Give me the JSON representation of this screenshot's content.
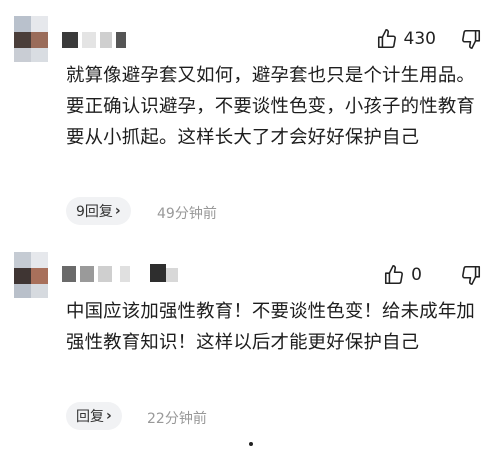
{
  "comments": [
    {
      "likes": "430",
      "text": "就算像避孕套又如何，避孕套也只是个计生用品。要正确认识避孕，不要谈性色变，小孩子的性教育要从小抓起。这样长大了才会好好保护自己",
      "reply_label": "9回复",
      "time": "49分钟前"
    },
    {
      "likes": "0",
      "text": "中国应该加强性教育！不要谈性色变！给未成年加强性教育知识！这样以后才能更好保护自己",
      "reply_label": "回复",
      "time": "22分钟前"
    }
  ],
  "icons": {
    "like": "thumbs-up-icon",
    "dislike": "thumbs-down-icon",
    "reply_chevron": "chevron-right-icon"
  },
  "colors": {
    "reply_bg": "#f1f2f4",
    "time_text": "#999999"
  }
}
